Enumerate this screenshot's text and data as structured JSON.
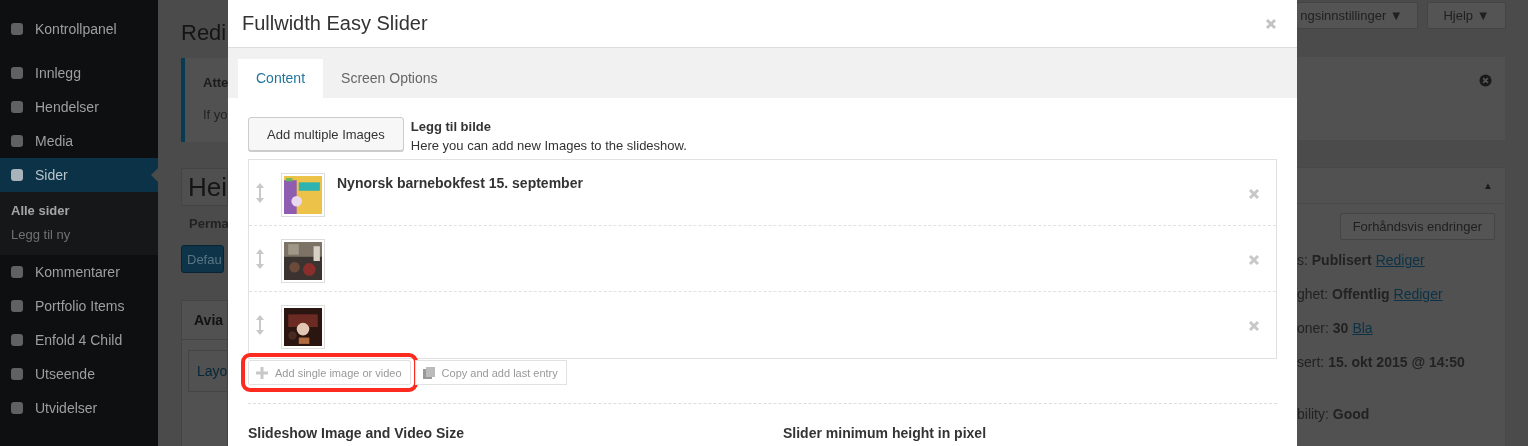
{
  "sidebar": {
    "items": [
      {
        "label": "Kontrollpanel",
        "selected": false
      },
      {
        "label": "Innlegg",
        "selected": false
      },
      {
        "label": "Hendelser",
        "selected": false
      },
      {
        "label": "Media",
        "selected": false
      },
      {
        "label": "Sider",
        "selected": true,
        "children": [
          {
            "label": "Alle sider",
            "selected": true
          },
          {
            "label": "Legg til ny",
            "selected": false
          }
        ]
      },
      {
        "label": "Kommentarer",
        "selected": false
      },
      {
        "label": "Portfolio Items",
        "selected": false
      },
      {
        "label": "Enfold 4 Child",
        "selected": false
      },
      {
        "label": "Utseende",
        "selected": false
      },
      {
        "label": "Utvidelser",
        "selected": false
      }
    ]
  },
  "page_left": {
    "title": "Redi",
    "notice_title": "Atte",
    "notice_text": "If yo",
    "title_field": "Hei",
    "permalink": "Perma",
    "default_button": "Defau",
    "box_title": "Avia",
    "layout_tab": "Layo"
  },
  "page_right": {
    "screen_options": "ngsinnstillinger ▼",
    "help": "Hjelp ▼",
    "publish_toggle": "▲",
    "preview_button": "Forhåndsvis endringer",
    "rows": [
      {
        "label": "s:",
        "value": "Publisert",
        "link": "Rediger"
      },
      {
        "label": "ghet:",
        "value": "Offentlig",
        "link": "Rediger"
      },
      {
        "label": "oner:",
        "value": "30",
        "link": "Bla"
      },
      {
        "label": "sert:",
        "value": "15. okt 2015 @ 14:50"
      },
      {
        "label": "bility:",
        "value": "Good"
      }
    ]
  },
  "modal": {
    "title": "Fullwidth Easy Slider",
    "tabs": [
      {
        "label": "Content",
        "selected": true
      },
      {
        "label": "Screen Options",
        "selected": false
      }
    ],
    "add_multiple": "Add multiple Images",
    "add_heading": "Legg til bilde",
    "add_description": "Here you can add new Images to the slideshow.",
    "entries": [
      {
        "title": "Nynorsk barnebokfest 15. september",
        "kind": "picture"
      },
      {
        "kind": "picture"
      },
      {
        "kind": "picture"
      }
    ],
    "actions": [
      {
        "label": "Add single image or video",
        "kind": "add",
        "highlighted": true
      },
      {
        "label": "Copy and add last entry",
        "kind": "copy",
        "highlighted": false
      }
    ],
    "settings": [
      {
        "heading": "Slideshow Image and Video Size"
      },
      {
        "heading": "Slider minimum height in pixel"
      }
    ]
  }
}
